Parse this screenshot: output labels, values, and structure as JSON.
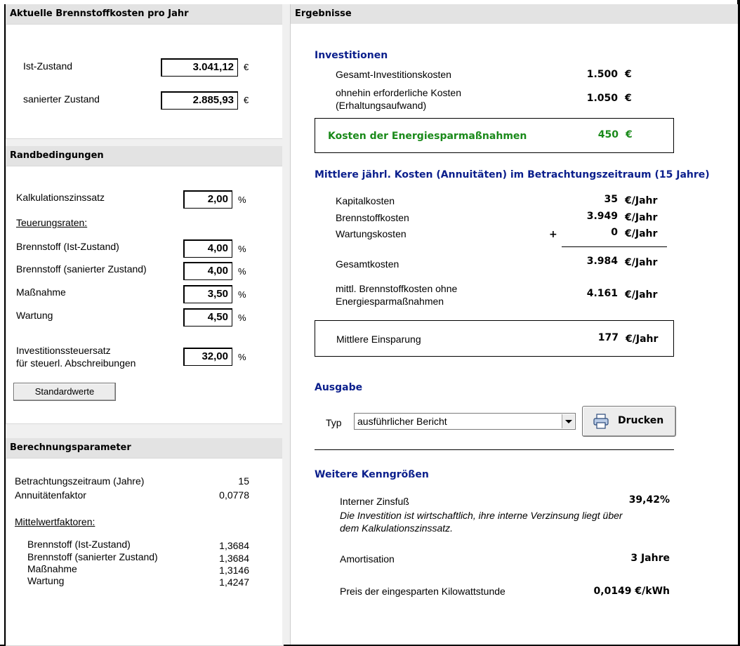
{
  "left": {
    "fuel_costs": {
      "title": "Aktuelle Brennstoffkosten pro Jahr",
      "ist_label": "Ist-Zustand",
      "ist_value": "3.041,12",
      "ist_unit": "€",
      "saniert_label": "sanierter Zustand",
      "saniert_value": "2.885,93",
      "saniert_unit": "€"
    },
    "conditions": {
      "title": "Randbedingungen",
      "zins_label": "Kalkulationszinssatz",
      "zins_value": "2,00",
      "percent": "%",
      "teuerung_label": "Teuerungsraten:",
      "rows": [
        {
          "label": "Brennstoff (Ist-Zustand)",
          "value": "4,00"
        },
        {
          "label": "Brennstoff (sanierter Zustand)",
          "value": "4,00"
        },
        {
          "label": "Maßnahme",
          "value": "3,50"
        },
        {
          "label": "Wartung",
          "value": "4,50"
        }
      ],
      "steuer_label_1": "Investitionssteuersatz",
      "steuer_label_2": "für steuerl. Abschreibungen",
      "steuer_value": "32,00",
      "defaults_button": "Standardwerte"
    },
    "params": {
      "title": "Berechnungsparameter",
      "zeitraum_label": "Betrachtungszeitraum (Jahre)",
      "zeitraum_value": "15",
      "annuitaet_label": "Annuitätenfaktor",
      "annuitaet_value": "0,0778",
      "mittelwert_label": "Mittelwertfaktoren:",
      "factors": [
        {
          "label": "Brennstoff (Ist-Zustand)",
          "value": "1,3684"
        },
        {
          "label": "Brennstoff (sanierter Zustand)",
          "value": "1,3684"
        },
        {
          "label": "Maßnahme",
          "value": "1,3146"
        },
        {
          "label": "Wartung",
          "value": "1,4247"
        }
      ]
    }
  },
  "right": {
    "title": "Ergebnisse",
    "invest": {
      "heading": "Investitionen",
      "gesamt_label": "Gesamt-Investitionskosten",
      "gesamt_value": "1.500",
      "ohnehin_label_1": "ohnehin erforderliche Kosten",
      "ohnehin_label_2": "(Erhaltungsaufwand)",
      "ohnehin_value": "1.050",
      "euro": "€",
      "energie_label": "Kosten der Energiesparmaßnahmen",
      "energie_value": "450"
    },
    "annuity": {
      "heading": "Mittlere jährl. Kosten (Annuitäten) im Betrachtungszeitraum (15 Jahre)",
      "unit": "€/Jahr",
      "kapital_label": "Kapitalkosten",
      "kapital_value": "35",
      "brennstoff_label": "Brennstoffkosten",
      "brennstoff_value": "3.949",
      "wartung_label": "Wartungskosten",
      "plus": "+",
      "wartung_value": "0",
      "gesamt_label": "Gesamtkosten",
      "gesamt_value": "3.984",
      "mittl_label_1": "mittl. Brennstoffkosten ohne",
      "mittl_label_2": "Energiesparmaßnahmen",
      "mittl_value": "4.161",
      "einsparung_label": "Mittlere Einsparung",
      "einsparung_value": "177"
    },
    "output": {
      "heading": "Ausgabe",
      "typ_label": "Typ",
      "typ_value": "ausführlicher Bericht",
      "print_button": "Drucken"
    },
    "more": {
      "heading": "Weitere Kenngrößen",
      "zinsfuss_label": "Interner Zinsfuß",
      "zinsfuss_value": "39,42%",
      "note_1": "Die Investition ist wirtschaftlich, ihre interne Verzinsung liegt über",
      "note_2": "dem Kalkulationszinssatz.",
      "amort_label": "Amortisation",
      "amort_value": "3 Jahre",
      "preis_label": "Preis der eingesparten Kilowattstunde",
      "preis_value": "0,0149 €/kWh"
    }
  }
}
